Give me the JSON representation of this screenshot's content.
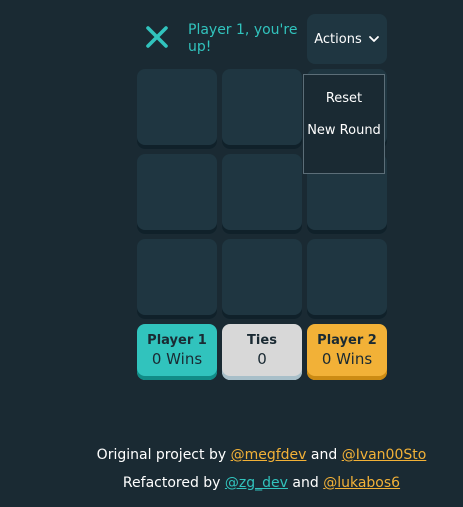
{
  "header": {
    "turn_icon": "x-icon",
    "turn_text": "Player 1, you're up!",
    "actions_label": "Actions",
    "actions_icon": "chevron-down-icon"
  },
  "menu": {
    "items": [
      {
        "label": "Reset"
      },
      {
        "label": "New Round"
      }
    ]
  },
  "board": {
    "cells": [
      "",
      "",
      "",
      "",
      "",
      "",
      "",
      "",
      ""
    ]
  },
  "scores": [
    {
      "label": "Player 1",
      "value": "0 Wins"
    },
    {
      "label": "Ties",
      "value": "0"
    },
    {
      "label": "Player 2",
      "value": "0 Wins"
    }
  ],
  "credits": {
    "line1_prefix": "Original project by ",
    "line1_link1": "@megfdev",
    "line1_mid": " and ",
    "line1_link2": "@Ivan00Sto",
    "line2_prefix": "Refactored by ",
    "line2_link1": "@zg_dev",
    "line2_mid": " and ",
    "line2_link2": "@lukabos6"
  },
  "colors": {
    "background": "#1a2a33",
    "cell": "#1f3641",
    "teal": "#31c3bd",
    "yellow": "#f2b137",
    "silver": "#d8d8d8"
  }
}
